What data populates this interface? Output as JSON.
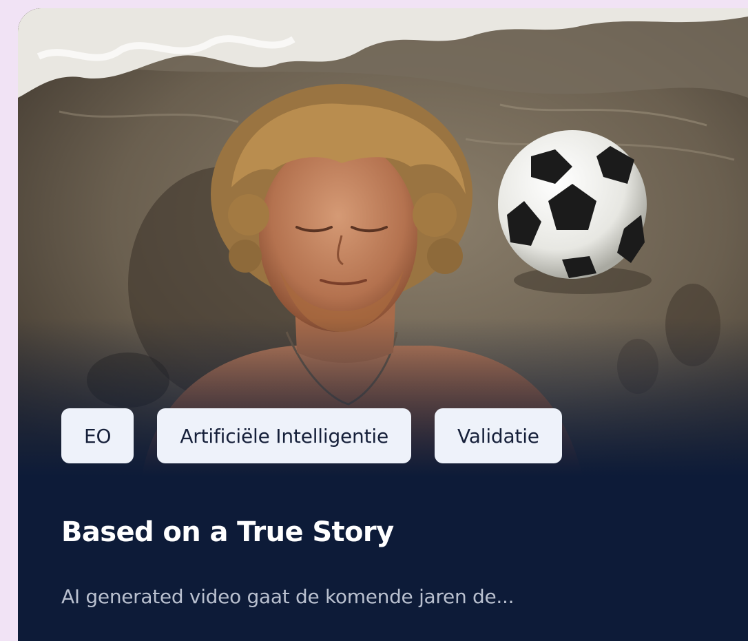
{
  "card": {
    "image": {
      "subject": "young man with curly blond hair lying on wet sand beside a soccer ball at the shoreline"
    },
    "tags": [
      {
        "label": "EO"
      },
      {
        "label": "Artificiële Intelligentie"
      },
      {
        "label": "Validatie"
      }
    ],
    "title": "Based on a True Story",
    "excerpt": "AI generated video gaat de komende jaren de..."
  },
  "colors": {
    "page_background": "#f1e3f5",
    "card_background": "#0d1b38",
    "tag_background": "#eef2fa",
    "tag_text": "#16203a",
    "title_text": "#ffffff",
    "excerpt_text": "#b9c0cf"
  },
  "icons": [
    "soccer-ball-graphic"
  ]
}
